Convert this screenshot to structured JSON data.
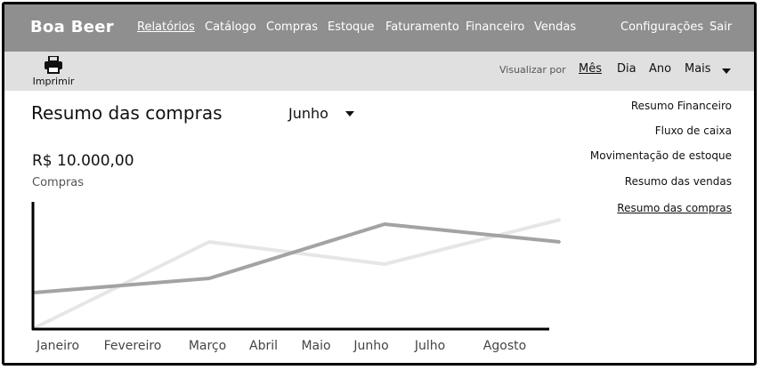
{
  "app": {
    "brand": "Boa Beer"
  },
  "nav": {
    "items": [
      {
        "label": "Relatórios",
        "active": true
      },
      {
        "label": "Catálogo"
      },
      {
        "label": "Compras"
      },
      {
        "label": "Estoque"
      },
      {
        "label": "Faturamento"
      },
      {
        "label": "Financeiro"
      },
      {
        "label": "Vendas"
      }
    ],
    "settings": "Configurações",
    "logout": "Sair"
  },
  "toolbar": {
    "print_label": "Imprimir",
    "view_by_label": "Visualizar por",
    "view_options": [
      {
        "label": "Mês",
        "active": true
      },
      {
        "label": "Dia"
      },
      {
        "label": "Ano"
      },
      {
        "label": "Mais"
      }
    ]
  },
  "main": {
    "title": "Resumo das compras",
    "month": "Junho",
    "amount": "R$ 10.000,00",
    "amount_label": "Compras"
  },
  "side_links": [
    {
      "label": "Resumo Financeiro"
    },
    {
      "label": "Fluxo de caixa"
    },
    {
      "label": "Movimentação de estoque"
    },
    {
      "label": "Resumo das vendas"
    },
    {
      "label": "Resumo das compras",
      "active": true
    }
  ],
  "chart_data": {
    "type": "line",
    "categories": [
      "Janeiro",
      "Fevereiro",
      "Março",
      "Abril",
      "Maio",
      "Junho",
      "Julho",
      "Agosto"
    ],
    "grid": false,
    "series": [
      {
        "color": "#e6e6e6",
        "points": [
          [
            0,
            0
          ],
          [
            2,
            97
          ],
          [
            4,
            72
          ],
          [
            6,
            122
          ]
        ]
      },
      {
        "color": "#a3a3a3",
        "points": [
          [
            0,
            40
          ],
          [
            2,
            56
          ],
          [
            4,
            117
          ],
          [
            6,
            97
          ]
        ]
      }
    ]
  }
}
